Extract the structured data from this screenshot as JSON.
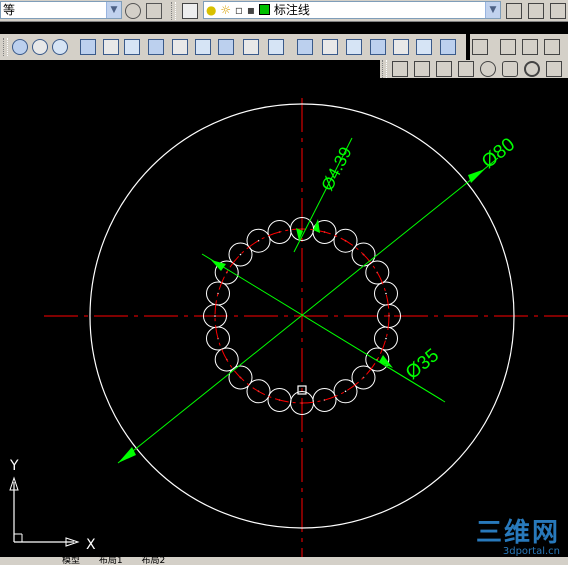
{
  "toolbar_top": {
    "style_dropdown_value": "等",
    "layer_dropdown_value": "标注线",
    "layer_color": "#00c000"
  },
  "toolbar_icons": [
    "union-icon",
    "subtract-icon",
    "intersect-icon",
    "extrude-icon",
    "move-3d-icon",
    "copy-icon",
    "delete-icon",
    "rotate-icon",
    "fillet-icon",
    "slice-icon",
    "section-icon",
    "box-icon",
    "wedge-icon",
    "cylinder-icon",
    "cone-icon",
    "sphere-icon",
    "torus-icon"
  ],
  "drawing": {
    "dimensions": {
      "outer": "Ø80",
      "small_circle": "Ø4.39",
      "pitch": "Ø35"
    },
    "ucs": {
      "x_label": "X",
      "y_label": "Y"
    },
    "colors": {
      "centerline": "#ff0000",
      "geometry": "#ffffff",
      "dimension": "#00ff00"
    }
  },
  "status_tabs": [
    "模型",
    "布局1",
    "布局2"
  ],
  "watermark": {
    "big": "三维网",
    "small": "3dportal.cn"
  }
}
